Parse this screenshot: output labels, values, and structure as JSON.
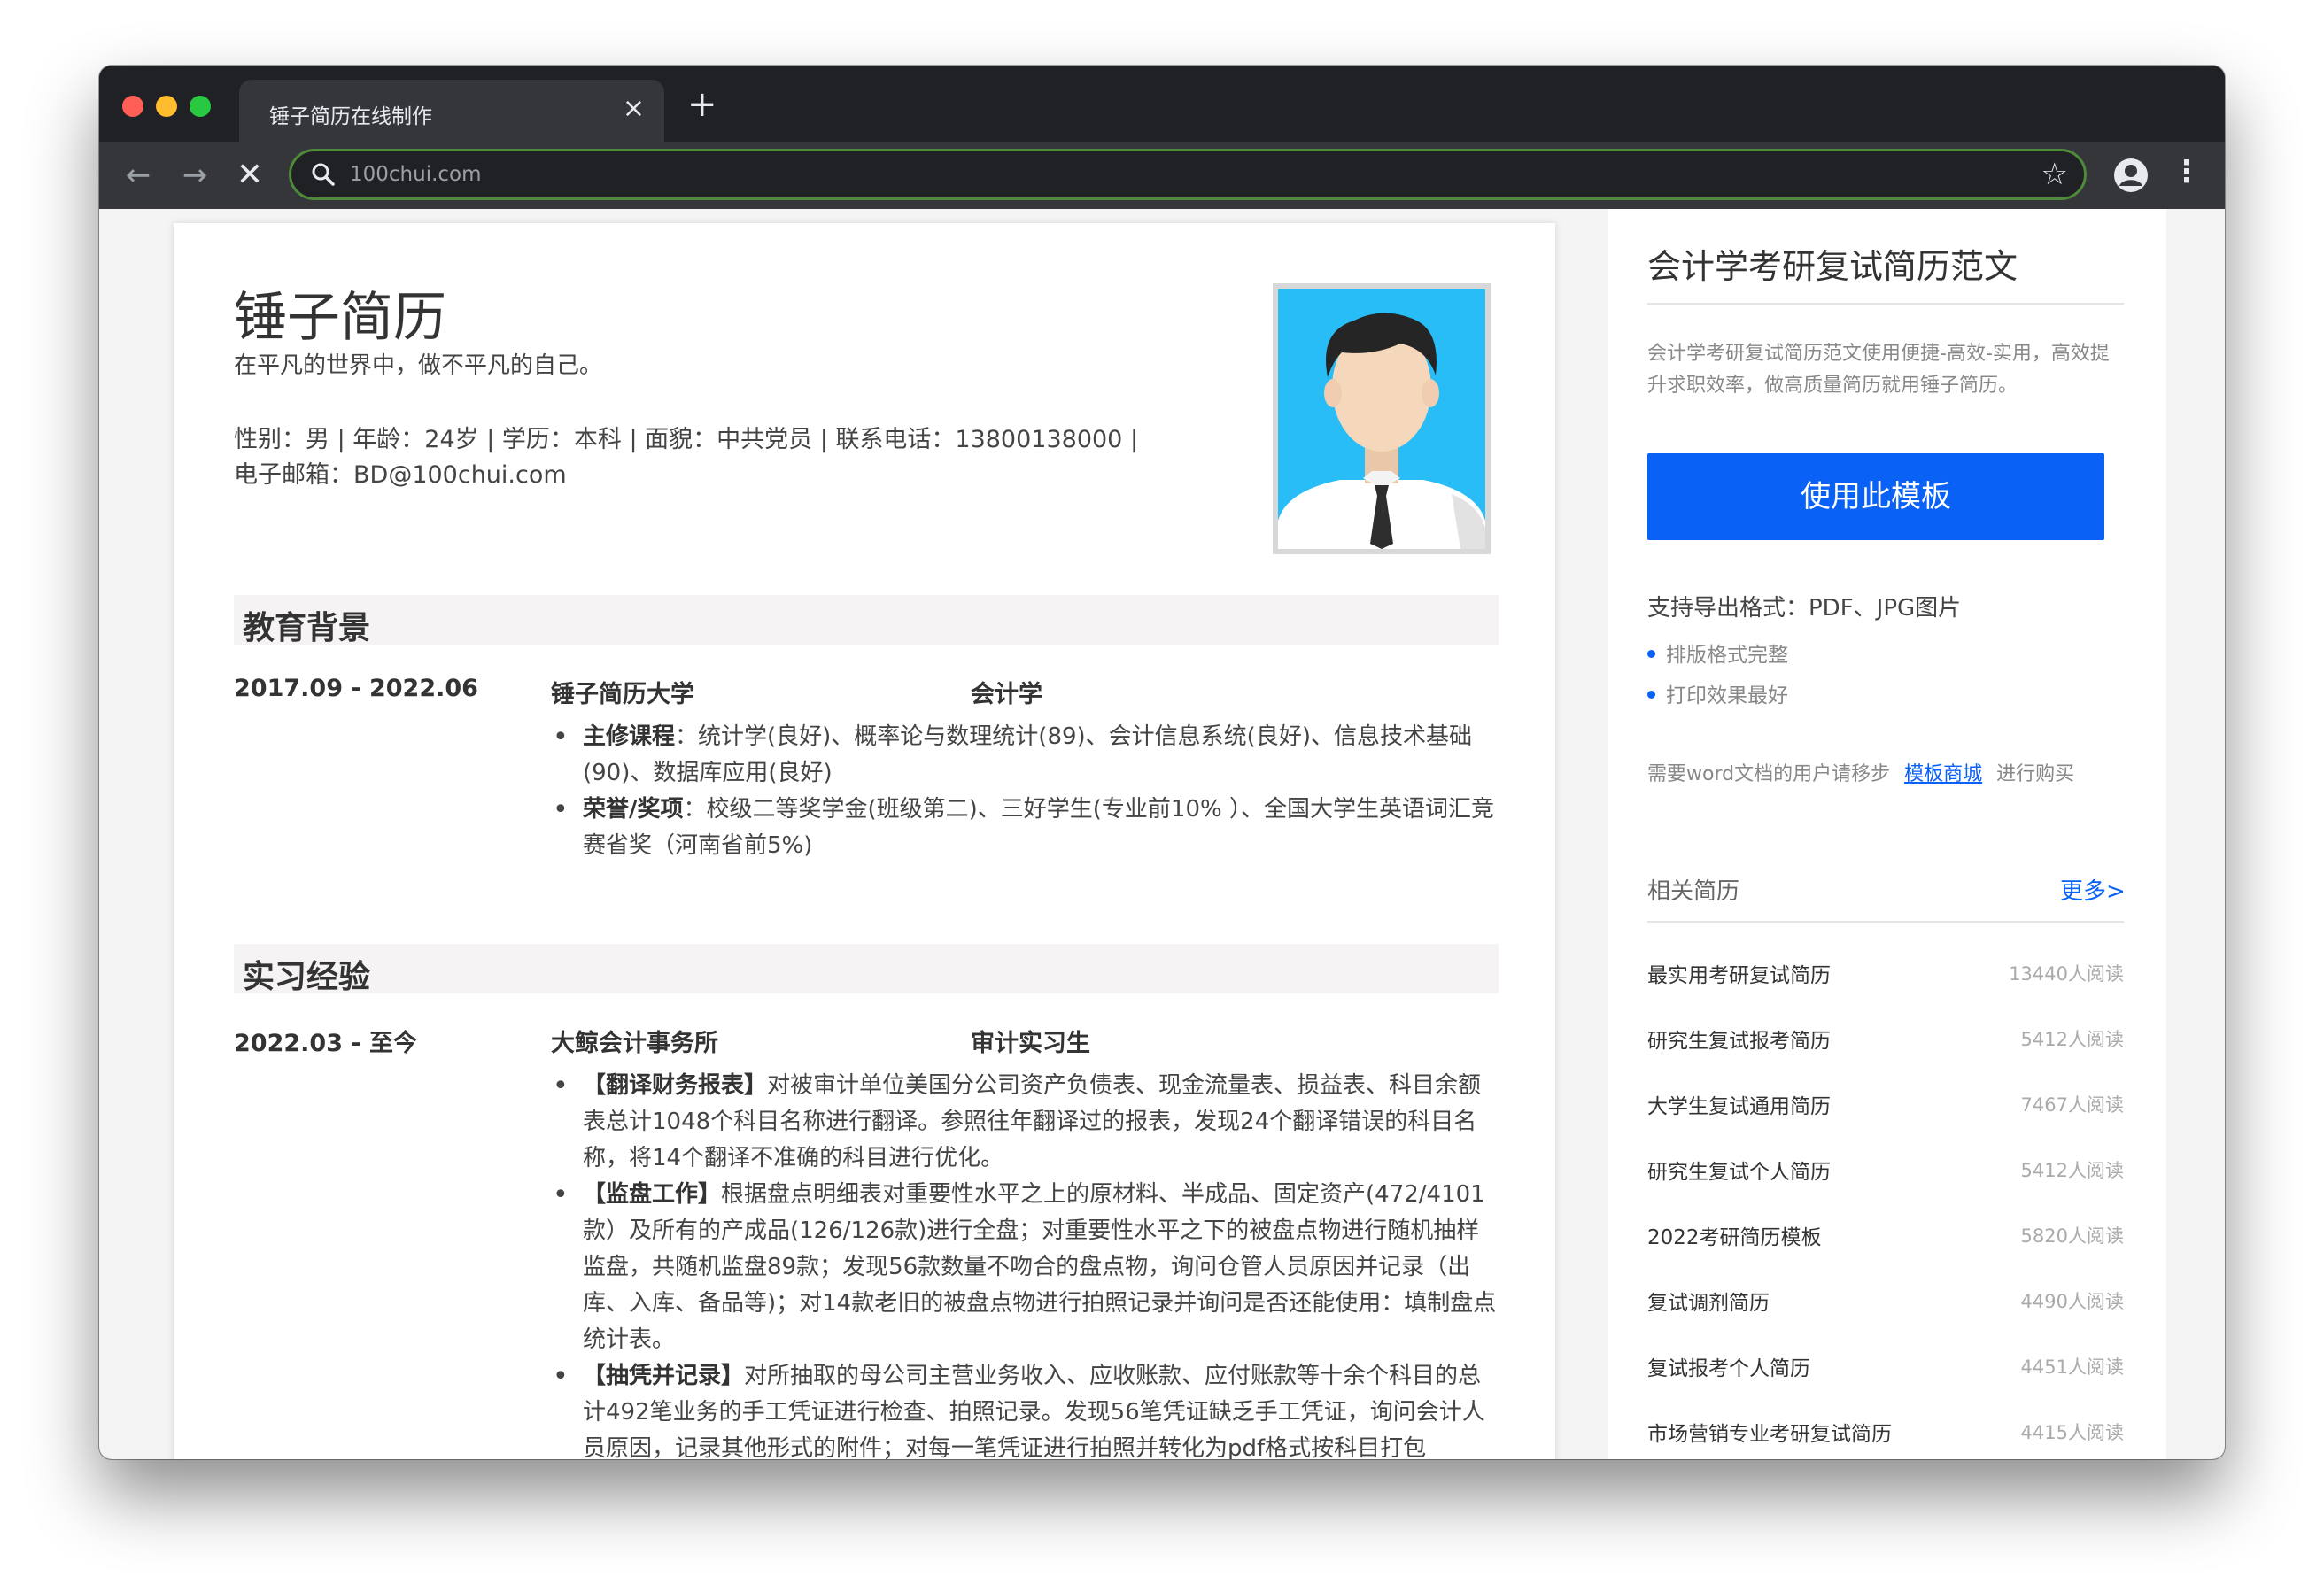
{
  "browser": {
    "tab_title": "锤子简历在线制作",
    "tab_close": "×",
    "new_tab": "+",
    "url": "100chui.com",
    "back": "←",
    "forward": "→",
    "stop": "✕",
    "star": "☆",
    "kebab": "⋮"
  },
  "resume": {
    "name": "锤子简历",
    "motto": "在平凡的世界中，做不平凡的自己。",
    "info_line1": "性别：男 | 年龄：24岁 | 学历：本科 | 面貌：中共党员 | 联系电话：13800138000 |",
    "info_line2": "电子邮箱：BD@100chui.com",
    "education": {
      "title": "教育背景",
      "date": "2017.09 - 2022.06",
      "school": "锤子简历大学",
      "major": "会计学",
      "bullets": [
        {
          "label": "主修课程",
          "text": "：统计学(良好)、概率论与数理统计(89)、会计信息系统(良好)、信息技术基础(90)、数据库应用(良好)"
        },
        {
          "label": "荣誉/奖项",
          "text": "：校级二等奖学金(班级第二)、三好学生(专业前10% ）、全国大学生英语词汇竞赛省奖（河南省前5%)"
        }
      ]
    },
    "internship": {
      "title": "实习经验",
      "date": "2022.03 - 至今",
      "company": "大鲸会计事务所",
      "role": "审计实习生",
      "bullets": [
        {
          "label": "【翻译财务报表】",
          "text": "对被审计单位美国分公司资产负债表、现金流量表、损益表、科目余额表总计1048个科目名称进行翻译。参照往年翻译过的报表，发现24个翻译错误的科目名称，将14个翻译不准确的科目进行优化。"
        },
        {
          "label": "【监盘工作】",
          "text": "根据盘点明细表对重要性水平之上的原材料、半成品、固定资产(472/4101款）及所有的产成品(126/126款)进行全盘；对重要性水平之下的被盘点物进行随机抽样监盘，共随机监盘89款；发现56款数量不吻合的盘点物，询问仓管人员原因并记录（出库、入库、备品等)；对14款老旧的被盘点物进行拍照记录并询问是否还能使用：填制盘点统计表。"
        },
        {
          "label": "【抽凭并记录】",
          "text": "对所抽取的母公司主营业务收入、应收账款、应付账款等十余个科目的总计492笔业务的手工凭证进行检查、拍照记录。发现56笔凭证缺乏手工凭证，询问会计人员原因，记录其他形式的附件；对每一笔凭证进行拍照并转化为pdf格式按科目打包"
        }
      ]
    }
  },
  "sidebar": {
    "title": "会计学考研复试简历范文",
    "description": "会计学考研复试简历范文使用便捷-高效-实用，高效提升求职效率，做高质量简历就用锤子简历。",
    "use_button": "使用此模板",
    "formats": "支持导出格式：PDF、JPG图片",
    "features": [
      "排版格式完整",
      "打印效果最好"
    ],
    "word_prefix": "需要word文档的用户请移步",
    "word_link": "模板商城",
    "word_suffix": "进行购买",
    "related_title": "相关简历",
    "more": "更多>",
    "related": [
      {
        "title": "最实用考研复试简历",
        "reads": "13440人阅读"
      },
      {
        "title": "研究生复试报考简历",
        "reads": "5412人阅读"
      },
      {
        "title": "大学生复试通用简历",
        "reads": "7467人阅读"
      },
      {
        "title": "研究生复试个人简历",
        "reads": "5412人阅读"
      },
      {
        "title": "2022考研简历模板",
        "reads": "5820人阅读"
      },
      {
        "title": "复试调剂简历",
        "reads": "4490人阅读"
      },
      {
        "title": "复试报考个人简历",
        "reads": "4451人阅读"
      },
      {
        "title": "市场营销专业考研复试简历",
        "reads": "4415人阅读"
      }
    ]
  }
}
